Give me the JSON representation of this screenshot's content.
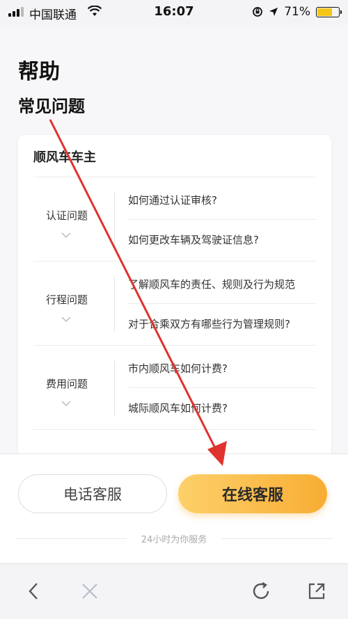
{
  "status_bar": {
    "carrier": "中国联通",
    "time": "16:07",
    "battery": "71%",
    "battery_level": 0.71
  },
  "page": {
    "title": "帮助",
    "subtitle": "常见问题"
  },
  "card": {
    "title": "顺风车车主",
    "groups": [
      {
        "category": "认证问题",
        "questions": [
          "如何通过认证审核?",
          "如何更改车辆及驾驶证信息?"
        ]
      },
      {
        "category": "行程问题",
        "questions": [
          "了解顺风车的责任、规则及行为规范",
          "对于合乘双方有哪些行为管理规则?"
        ]
      },
      {
        "category": "费用问题",
        "questions": [
          "市内顺风车如何计费?",
          "城际顺风车如何计费?"
        ]
      }
    ]
  },
  "bottom": {
    "phone_button": "电话客服",
    "online_button": "在线客服",
    "service_note": "24小时为你服务"
  },
  "toolbar": {
    "icons": [
      "back-icon",
      "close-icon",
      "refresh-icon",
      "share-icon"
    ]
  },
  "colors": {
    "accent_start": "#fdd06a",
    "accent_end": "#f8ad33",
    "annotation_arrow": "#e0322e"
  }
}
